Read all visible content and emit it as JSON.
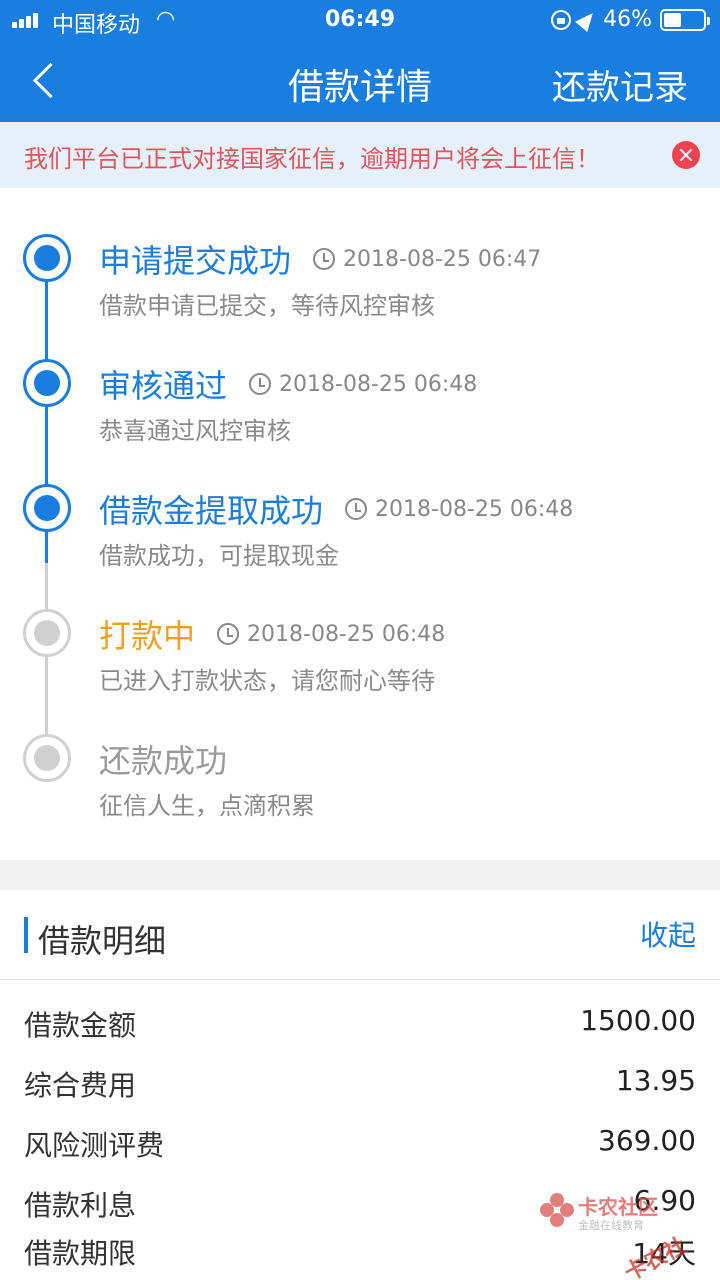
{
  "status_bar": {
    "carrier": "中国移动",
    "time": "06:49",
    "battery": "46%",
    "battery_level": 0.46
  },
  "nav": {
    "title": "借款详情",
    "right_action": "还款记录"
  },
  "notice": {
    "text": "我们平台已正式对接国家征信，逾期用户将会上征信！"
  },
  "timeline": [
    {
      "title": "申请提交成功",
      "time": "2018-08-25 06:47",
      "desc": "借款申请已提交，等待风控审核",
      "state": "done"
    },
    {
      "title": "审核通过",
      "time": "2018-08-25 06:48",
      "desc": "恭喜通过风控审核",
      "state": "done"
    },
    {
      "title": "借款金提取成功",
      "time": "2018-08-25 06:48",
      "desc": "借款成功，可提取现金",
      "state": "done"
    },
    {
      "title": "打款中",
      "time": "2018-08-25 06:48",
      "desc": "已进入打款状态，请您耐心等待",
      "state": "current"
    },
    {
      "title": "还款成功",
      "time": "",
      "desc": "征信人生，点滴积累",
      "state": "pending"
    }
  ],
  "details": {
    "title": "借款明细",
    "toggle": "收起",
    "rows": [
      {
        "label": "借款金额",
        "value": "1500.00"
      },
      {
        "label": "综合费用",
        "value": "13.95"
      },
      {
        "label": "风险测评费",
        "value": "369.00"
      },
      {
        "label": "借款利息",
        "value": "6.90"
      },
      {
        "label": "借款期限",
        "value": "14天"
      }
    ]
  },
  "watermark": {
    "name": "卡农社区",
    "sub": "金融在线教育",
    "name2": "卡农社区"
  },
  "colors": {
    "accent": "#1a7ee0",
    "warning": "#e4555a",
    "in_progress": "#f0a020",
    "inactive": "#d0d0d0"
  }
}
